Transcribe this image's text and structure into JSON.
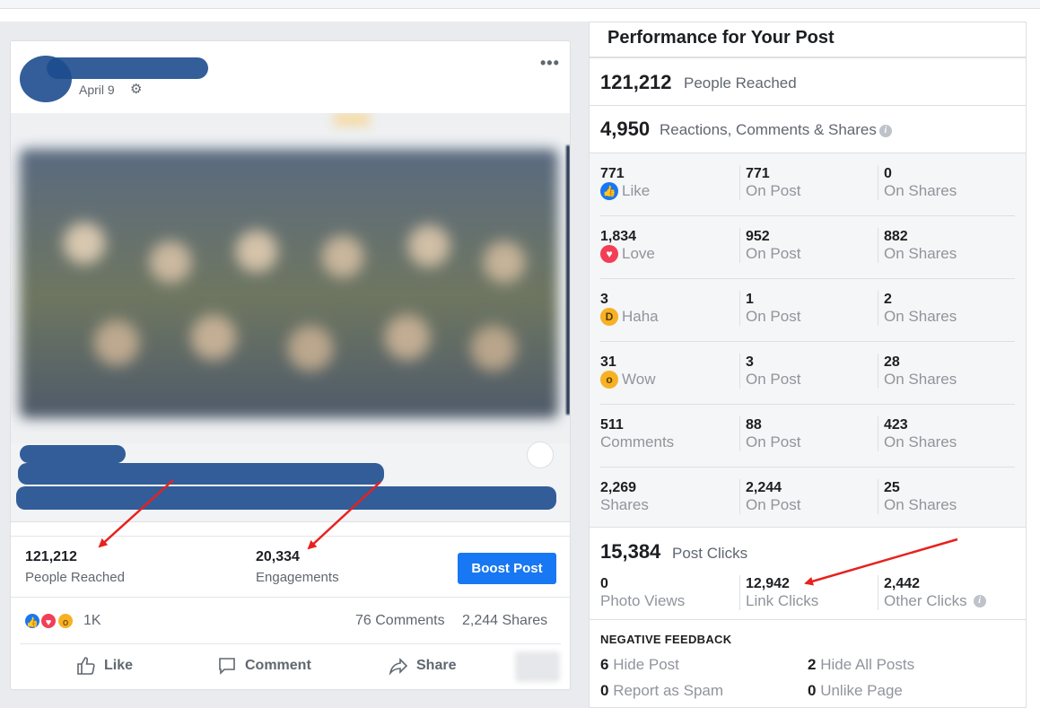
{
  "post": {
    "date": "April 9",
    "stats": {
      "reach_value": "121,212",
      "reach_label": "People Reached",
      "engagements_value": "20,334",
      "engagements_label": "Engagements",
      "boost_label": "Boost Post"
    },
    "reactions": {
      "count": "1K",
      "comments": "76 Comments",
      "shares": "2,244 Shares"
    },
    "actions": {
      "like": "Like",
      "comment": "Comment",
      "share": "Share"
    }
  },
  "performance": {
    "title": "Performance for Your Post",
    "people_reached_value": "121,212",
    "people_reached_label": "People Reached",
    "reactions_value": "4,950",
    "reactions_label": "Reactions, Comments & Shares",
    "breakdown": [
      {
        "total": "771",
        "label": "Like",
        "on_post": "771",
        "on_shares": "0"
      },
      {
        "total": "1,834",
        "label": "Love",
        "on_post": "952",
        "on_shares": "882"
      },
      {
        "total": "3",
        "label": "Haha",
        "on_post": "1",
        "on_shares": "2"
      },
      {
        "total": "31",
        "label": "Wow",
        "on_post": "3",
        "on_shares": "28"
      },
      {
        "total": "511",
        "label": "Comments",
        "on_post": "88",
        "on_shares": "423"
      },
      {
        "total": "2,269",
        "label": "Shares",
        "on_post": "2,244",
        "on_shares": "25"
      }
    ],
    "on_post_label": "On Post",
    "on_shares_label": "On Shares",
    "post_clicks_value": "15,384",
    "post_clicks_label": "Post Clicks",
    "clicks": {
      "photo_views_value": "0",
      "photo_views_label": "Photo Views",
      "link_clicks_value": "12,942",
      "link_clicks_label": "Link Clicks",
      "other_clicks_value": "2,442",
      "other_clicks_label": "Other Clicks"
    },
    "negative_feedback": {
      "title": "NEGATIVE FEEDBACK",
      "hide_post_value": "6",
      "hide_post_label": "Hide Post",
      "hide_all_value": "2",
      "hide_all_label": "Hide All Posts",
      "spam_value": "0",
      "spam_label": "Report as Spam",
      "unlike_value": "0",
      "unlike_label": "Unlike Page"
    }
  },
  "colors": {
    "facebook_blue": "#1877f2",
    "annotation_red": "#e8211d",
    "redaction": "#1d4d8f"
  },
  "icons": [
    "gear-icon",
    "more-options-icon",
    "like-reaction-icon",
    "love-reaction-icon",
    "wow-reaction-icon",
    "haha-reaction-icon",
    "thumbs-up-icon",
    "comment-icon",
    "share-arrow-icon",
    "info-icon"
  ]
}
